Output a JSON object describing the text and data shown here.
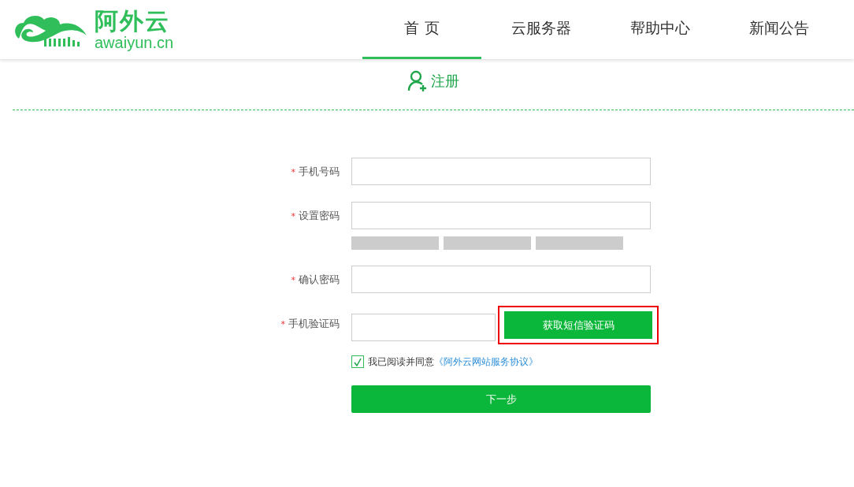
{
  "logo": {
    "name": "阿外云",
    "domain": "awaiyun.cn"
  },
  "nav": [
    {
      "label": "首 页",
      "selected": true
    },
    {
      "label": "云服务器",
      "selected": false
    },
    {
      "label": "帮助中心",
      "selected": false
    },
    {
      "label": "新闻公告",
      "selected": false
    }
  ],
  "page_title": "注册",
  "fields": [
    {
      "kind": "text",
      "required_mark": "*",
      "label": "手机号码"
    },
    {
      "kind": "password",
      "required_mark": "*",
      "label": "设置密码"
    },
    {
      "kind": "text",
      "required_mark": "*",
      "label": "确认密码"
    },
    {
      "kind": "code",
      "required_mark": "*",
      "label": "手机验证码",
      "button": {
        "label": "获取短信验证码",
        "highlighted": true
      }
    }
  ],
  "agreement": {
    "checked": true,
    "text": "我已阅读并同意",
    "link": "《阿外云网站服务协议》"
  },
  "submit": "下一步"
}
